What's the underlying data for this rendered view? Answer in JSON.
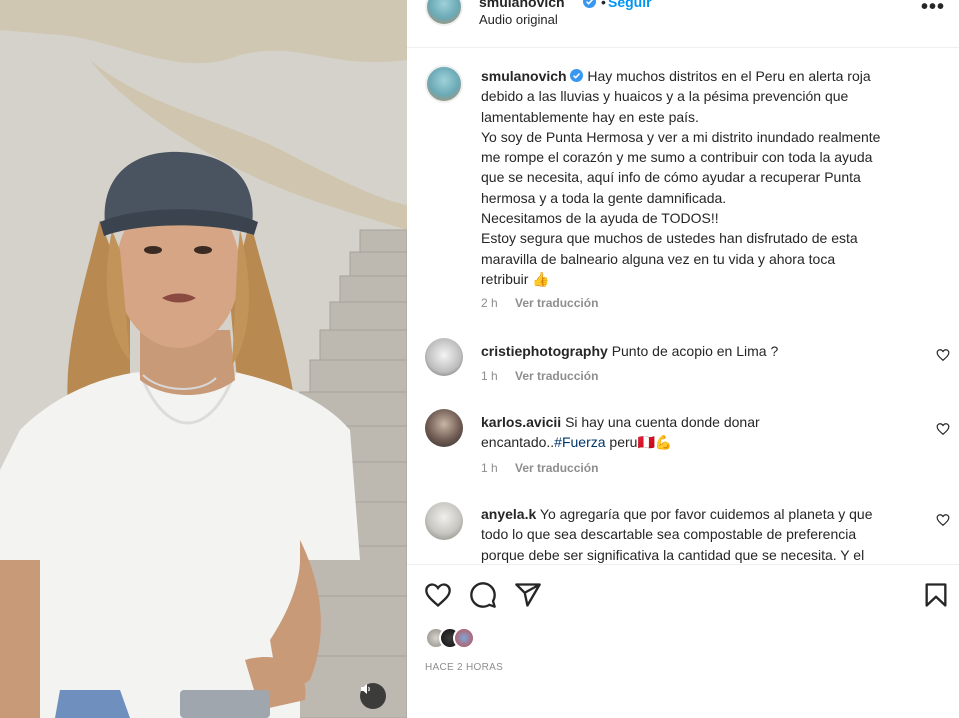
{
  "header": {
    "username": "smulanovich",
    "dot": "•",
    "follow_label": "Seguir",
    "audio_label": "Audio original",
    "more_icon": "more-horizontal-icon",
    "more_glyph": "•••"
  },
  "caption": {
    "username": "smulanovich",
    "text_lines": [
      "Hay muchos distritos en el Peru en alerta roja",
      "debido a las lluvias y huaicos y a la pésima prevención que",
      "lamentablemente hay en este país.",
      "Yo soy de Punta Hermosa y ver a mi distrito inundado realmente",
      "me rompe el corazón y me sumo a contribuir con toda la ayuda",
      "que se necesita, aquí info de cómo ayudar a recuperar Punta",
      "hermosa y a toda la gente damnificada.",
      "Necesitamos de la ayuda de TODOS!!",
      "Estoy segura que muchos de ustedes han disfrutado de esta",
      "maravilla de balneario alguna vez en tu vida y ahora toca",
      "retribuir"
    ],
    "emoji": "👍",
    "time": "2 h",
    "translate_label": "Ver traducción"
  },
  "comments": [
    {
      "username": "cristiephotography",
      "text": "Punto de acopio en Lima ?",
      "time": "1 h",
      "translate_label": "Ver traducción"
    },
    {
      "username": "karlos.avicii",
      "text": "Si hay una cuenta donde donar",
      "text_line2": "encantado..",
      "hashtag": "#Fuerza",
      "text_tail": " peru🇵🇪💪",
      "time": "1 h",
      "translate_label": "Ver traducción"
    },
    {
      "username": "anyela.k",
      "text": "Yo agregaría que por favor cuidemos al planeta y que",
      "text_line2": "todo lo que sea descartable sea compostable de preferencia",
      "text_line3": "porque debe ser significativa la cantidad que se necesita. Y el"
    }
  ],
  "actions": {
    "icons": [
      "heart-icon",
      "comment-icon",
      "share-icon",
      "bookmark-icon"
    ]
  },
  "timestamp": "HACE 2 HORAS",
  "colors": {
    "link_blue": "#0095f6",
    "text": "#262626",
    "secondary": "#8e8e8e",
    "hashtag": "#00376b",
    "verified": "#3897f0"
  }
}
